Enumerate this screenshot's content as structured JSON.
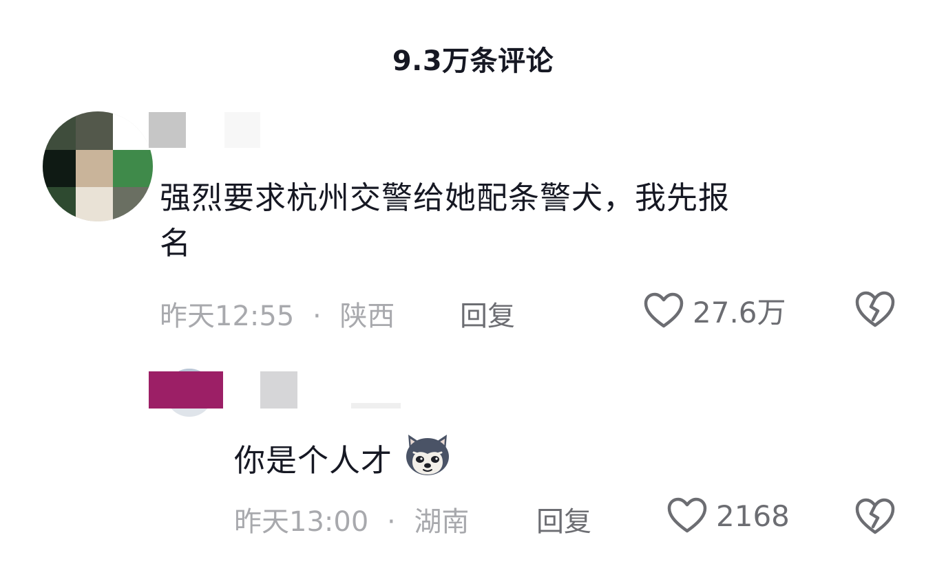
{
  "header": {
    "title": "9.3万条评论"
  },
  "comments": [
    {
      "text_line1": "强烈要求杭州交警给她配条警犬，我先报",
      "text_line2": "名",
      "time": "昨天12:55",
      "separator": "·",
      "location": "陕西",
      "reply_label": "回复",
      "likes": "27.6万"
    },
    {
      "text": "你是个人才",
      "emoji": "dog-emoji",
      "time": "昨天13:00",
      "separator": "·",
      "location": "湖南",
      "reply_label": "回复",
      "likes": "2168"
    }
  ],
  "icons": {
    "like": "heart-outline-icon",
    "dislike": "broken-heart-icon"
  },
  "colors": {
    "text_primary": "#161823",
    "text_meta": "#a8a9ad",
    "text_action": "#6c6d72"
  }
}
